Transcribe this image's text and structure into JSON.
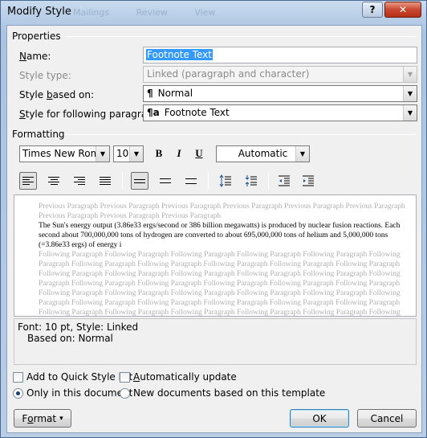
{
  "window": {
    "title": "Modify Style",
    "help_label": "?",
    "close_label": "✕",
    "ghost_tabs": [
      "Mailings",
      "Review",
      "View"
    ]
  },
  "properties": {
    "section_label": "Properties",
    "name_label_pre": "",
    "name_label_u": "N",
    "name_label_post": "ame:",
    "name_value": "Footnote Text",
    "style_type_label": "Style type:",
    "style_type_value": "Linked (paragraph and character)",
    "based_on_label_pre": "Style ",
    "based_on_label_u": "b",
    "based_on_label_post": "ased on:",
    "based_on_glyph": "¶",
    "based_on_value": "Normal",
    "following_label_pre": "",
    "following_label_u": "S",
    "following_label_post": "tyle for following paragraph:",
    "following_glyph": "¶a",
    "following_value": "Footnote Text"
  },
  "formatting": {
    "section_label": "Formatting",
    "font_name": "Times New Roman",
    "font_size": "10",
    "bold": "B",
    "italic": "I",
    "underline": "U",
    "color_value": "Automatic"
  },
  "preview": {
    "previous_text": "Previous Paragraph Previous Paragraph Previous Paragraph Previous Paragraph Previous Paragraph Previous Paragraph Previous Paragraph Previous Paragraph Previous Paragraph",
    "sample_text": "The Sun's energy output (3.86e33 ergs/second or 386 billion megawatts) is produced by nuclear fusion reactions. Each second about 700,000,000 tons of hydrogen are converted to about 695,000,000 tons of helium and 5,000,000 tons (=3.86e33 ergs) of energy i",
    "following_text": "Following Paragraph Following Paragraph Following Paragraph Following Paragraph Following Paragraph Following Paragraph Following Paragraph Following Paragraph Following Paragraph Following Paragraph Following Paragraph Following Paragraph Following Paragraph Following Paragraph Following Paragraph Following Paragraph Following Paragraph Following Paragraph Following Paragraph Following Paragraph Following Paragraph Following Paragraph Following Paragraph Following Paragraph Following Paragraph Following Paragraph Following Paragraph Following Paragraph Following Paragraph Following Paragraph Following Paragraph Following Paragraph Following Paragraph Following Paragraph Following Paragraph Following Paragraph Following Paragraph Following Paragraph Following Paragraph Following Paragraph Following Paragraph Following Paragraph"
  },
  "description": {
    "line1": "Font: 10 pt, Style: Linked",
    "line2": "Based on: Normal"
  },
  "options": {
    "add_quick_style": "Add to Quick Style list",
    "auto_update_pre": "",
    "auto_update_u": "A",
    "auto_update_post": "utomatically update",
    "only_document": "Only in this document",
    "new_documents": "New documents based on this template"
  },
  "buttons": {
    "format_pre": "F",
    "format_u": "o",
    "format_post": "rmat",
    "format_arrow": "▾",
    "ok": "OK",
    "cancel": "Cancel"
  }
}
